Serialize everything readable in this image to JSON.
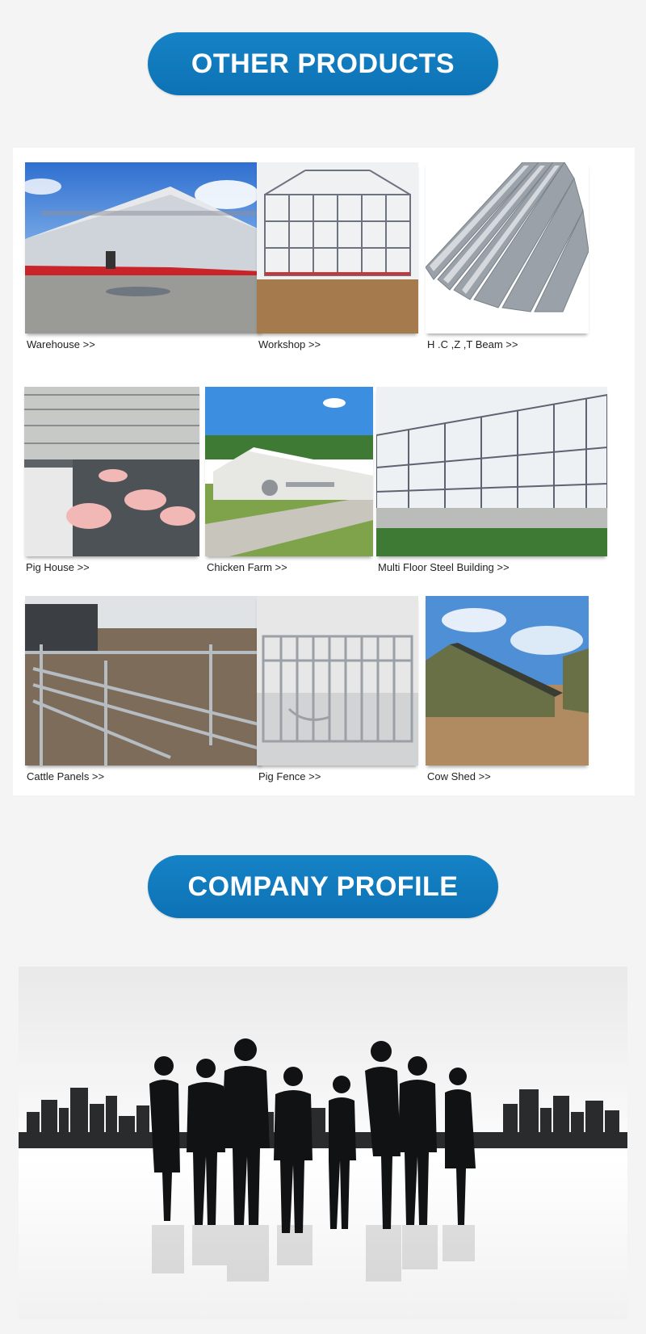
{
  "sections": {
    "products_heading": "OTHER PRODUCTS",
    "profile_heading": "COMPANY PROFILE"
  },
  "products": [
    {
      "label": "Warehouse  >>"
    },
    {
      "label": "Workshop  >>"
    },
    {
      "label": "H .C ,Z ,T Beam  >>"
    },
    {
      "label": "Pig House  >>"
    },
    {
      "label": "Chicken Farm  >>"
    },
    {
      "label": "Multi Floor Steel Building  >>"
    },
    {
      "label": "Cattle Panels  >>"
    },
    {
      "label": "Pig Fence  >>"
    },
    {
      "label": "Cow Shed  >>"
    }
  ],
  "colors": {
    "heading_pill": "#0f78bd",
    "background": "#f4f4f4",
    "panel": "#ffffff"
  }
}
